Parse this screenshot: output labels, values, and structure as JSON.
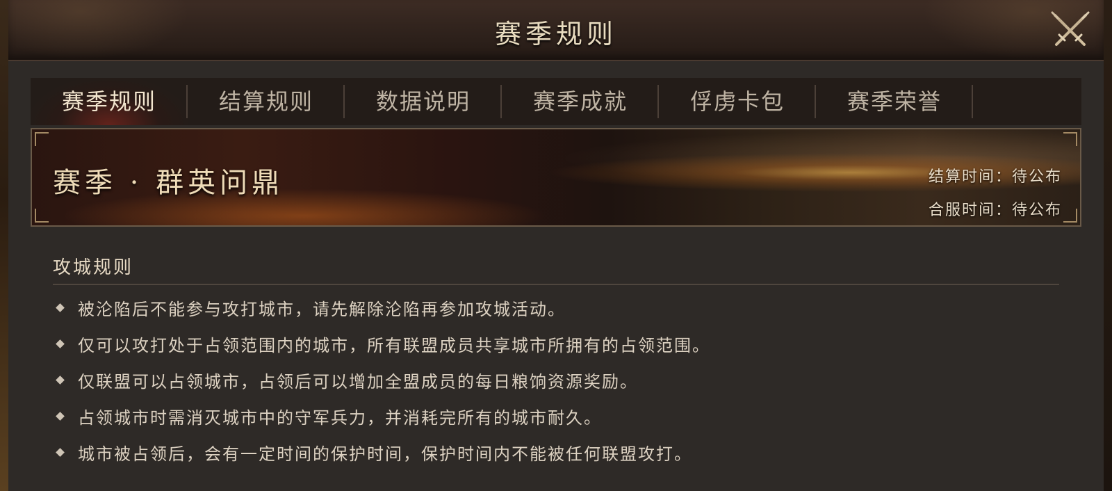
{
  "dialog": {
    "title": "赛季规则",
    "close_icon": "crossed-swords-close-icon"
  },
  "tabs": [
    {
      "label": "赛季规则",
      "active": true
    },
    {
      "label": "结算规则",
      "active": false
    },
    {
      "label": "数据说明",
      "active": false
    },
    {
      "label": "赛季成就",
      "active": false
    },
    {
      "label": "俘虏卡包",
      "active": false
    },
    {
      "label": "赛季荣誉",
      "active": false
    }
  ],
  "banner": {
    "season_name": "赛季 · 群英问鼎",
    "settlement_time": "结算时间：待公布",
    "merge_time": "合服时间：待公布"
  },
  "section": {
    "title": "攻城规则",
    "rules": [
      "被沦陷后不能参与攻打城市，请先解除沦陷再参加攻城活动。",
      "仅可以攻打处于占领范围内的城市，所有联盟成员共享城市所拥有的占领范围。",
      "仅联盟可以占领城市，占领后可以增加全盟成员的每日粮饷资源奖励。",
      "占领城市时需消灭城市中的守军兵力，并消耗完所有的城市耐久。",
      "城市被占领后，会有一定时间的保护时间，保护时间内不能被任何联盟攻打。"
    ]
  },
  "colors": {
    "title_text": "#e9dcc0",
    "active_tab_glow": "#962820",
    "panel_bg": "#2e2a27"
  }
}
